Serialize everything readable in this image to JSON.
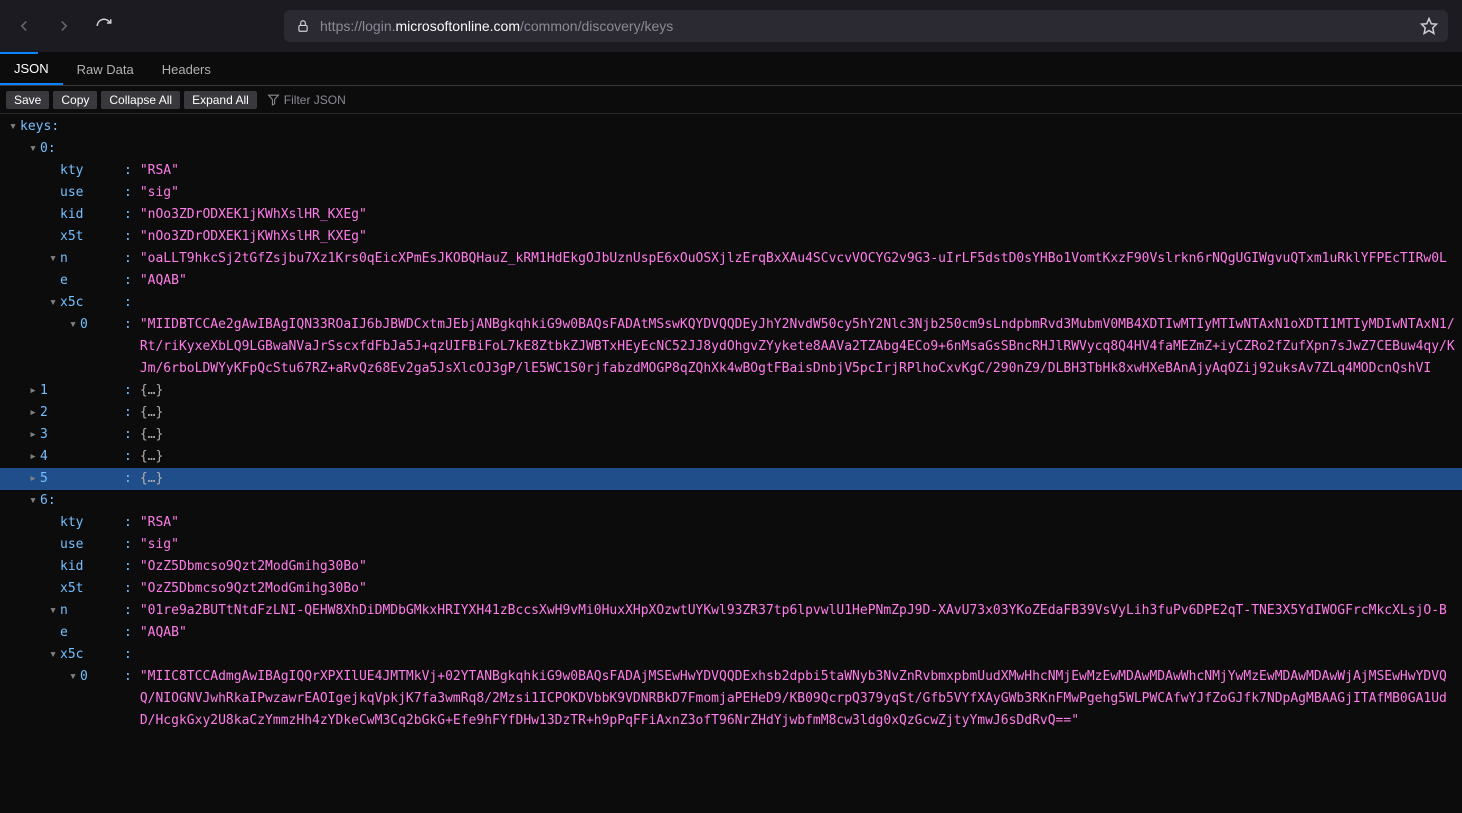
{
  "url": {
    "prefix": "https://login.",
    "host": "microsoftonline.com",
    "path": "/common/discovery/keys"
  },
  "tabs": {
    "json": "JSON",
    "raw": "Raw Data",
    "headers": "Headers"
  },
  "toolbar": {
    "save": "Save",
    "copy": "Copy",
    "collapse": "Collapse All",
    "expand": "Expand All",
    "filter_placeholder": "Filter JSON"
  },
  "labels": {
    "keys": "keys",
    "kty": "kty",
    "use": "use",
    "kid": "kid",
    "x5t": "x5t",
    "n": "n",
    "e": "e",
    "x5c": "x5c",
    "idx0": "0",
    "idx1": "1",
    "idx2": "2",
    "idx3": "3",
    "idx4": "4",
    "idx5": "5",
    "idx6": "6",
    "summary": "{…}"
  },
  "key0": {
    "kty": "\"RSA\"",
    "use": "\"sig\"",
    "kid": "\"nOo3ZDrODXEK1jKWhXslHR_KXEg\"",
    "x5t": "\"nOo3ZDrODXEK1jKWhXslHR_KXEg\"",
    "n": "\"oaLLT9hkcSj2tGfZsjbu7Xz1Krs0qEicXPmEsJKOBQHauZ_kRM1HdEkgOJbUznUspE6xOuOSXjlzErqBxXAu4SCvcvVOCYG2v9G3-uIrLF5dstD0sYHBo1VomtKxzF90Vslrkn6rNQgUGIWgvuQTxm1uRklYFPEcTIRw0L",
    "e": "\"AQAB\"",
    "x5c0": "\"MIIDBTCCAe2gAwIBAgIQN33ROaIJ6bJBWDCxtmJEbjANBgkqhkiG9w0BAQsFADAtMSswKQYDVQQDEyJhY2NvdW50cy5hY2Nlc3Njb250cm9sLndpbmRvd3MubmV0MB4XDTIwMTIyMTIwNTAxN1oXDTI1MTIyMDIwNTAxN1/Rt/riKyxeXbLQ9LGBwaNVaJrSscxfdFbJa5J+qzUIFBiFoL7kE8ZtbkZJWBTxHEyEcNC52JJ8ydOhgvZYykete8AAVa2TZAbg4ECo9+6nMsaGsSBncRHJlRWVycq8Q4HV4faMEZmZ+iyCZRo2fZufXpn7sJwZ7CEBuw4qy/KJm/6rboLDWYyKFpQcStu67RZ+aRvQz68Ev2ga5JsXlcOJ3gP/lE5WC1S0rjfabzdMOGP8qZQhXk4wBOgtFBaisDnbjV5pcIrjRPlhoCxvKgC/290nZ9/DLBH3TbHk8xwHXeBAnAjyAqOZij92uksAv7ZLq4MODcnQshVI"
  },
  "key6": {
    "kty": "\"RSA\"",
    "use": "\"sig\"",
    "kid": "\"OzZ5Dbmcso9Qzt2ModGmihg30Bo\"",
    "x5t": "\"OzZ5Dbmcso9Qzt2ModGmihg30Bo\"",
    "n": "\"01re9a2BUTtNtdFzLNI-QEHW8XhDiDMDbGMkxHRIYXH41zBccsXwH9vMi0HuxXHpXOzwtUYKwl93ZR37tp6lpvwlU1HePNmZpJ9D-XAvU73x03YKoZEdaFB39VsVyLih3fuPv6DPE2qT-TNE3X5YdIWOGFrcMkcXLsjO-B",
    "e": "\"AQAB\"",
    "x5c0": "\"MIIC8TCCAdmgAwIBAgIQQrXPXIlUE4JMTMkVj+02YTANBgkqhkiG9w0BAQsFADAjMSEwHwYDVQQDExhsb2dpbi5taWNyb3NvZnRvbmxpbmUudXMwHhcNMjEwMzEwMDAwMDAwWhcNMjYwMzEwMDAwMDAwWjAjMSEwHwYDVQQ/NIOGNVJwhRkaIPwzawrEAOIgejkqVpkjK7fa3wmRq8/2Mzsi1ICPOKDVbbK9VDNRBkD7FmomjaPEHeD9/KB09QcrpQ379yqSt/Gfb5VYfXAyGWb3RKnFMwPgehg5WLPWCAfwYJfZoGJfk7NDpAgMBAAGjITAfMB0GA1UdD/HcgkGxy2U8kaCzYmmzHh4zYDkeCwM3Cq2bGkG+Efe9hFYfDHw13DzTR+h9pPqFFiAxnZ3ofT96NrZHdYjwbfmM8cw3ldg0xQzGcwZjtyYmwJ6sDdRvQ==\""
  }
}
